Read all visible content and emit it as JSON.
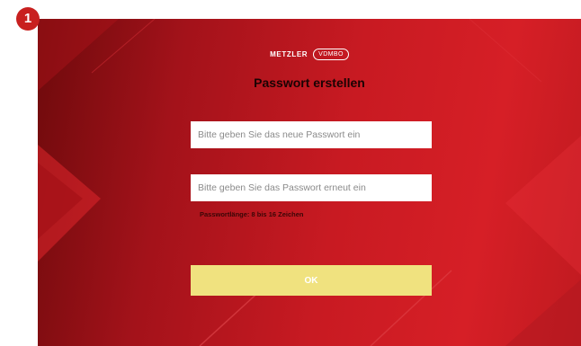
{
  "step": {
    "number": "1"
  },
  "brand": {
    "name": "METZLER",
    "sub": "VDMBO"
  },
  "form": {
    "title": "Passwort erstellen",
    "new_password": {
      "placeholder": "Bitte geben Sie das neue Passwort ein",
      "value": ""
    },
    "repeat_password": {
      "placeholder": "Bitte geben Sie das Passwort erneut ein",
      "value": ""
    },
    "hint": "Passwortlänge: 8 bis 16 Zeichen",
    "ok_label": "OK"
  },
  "colors": {
    "background_red": "#c81a22",
    "dark_red": "#6e0a0c",
    "button_yellow": "#f0e27f",
    "badge_red": "#c8201f"
  }
}
